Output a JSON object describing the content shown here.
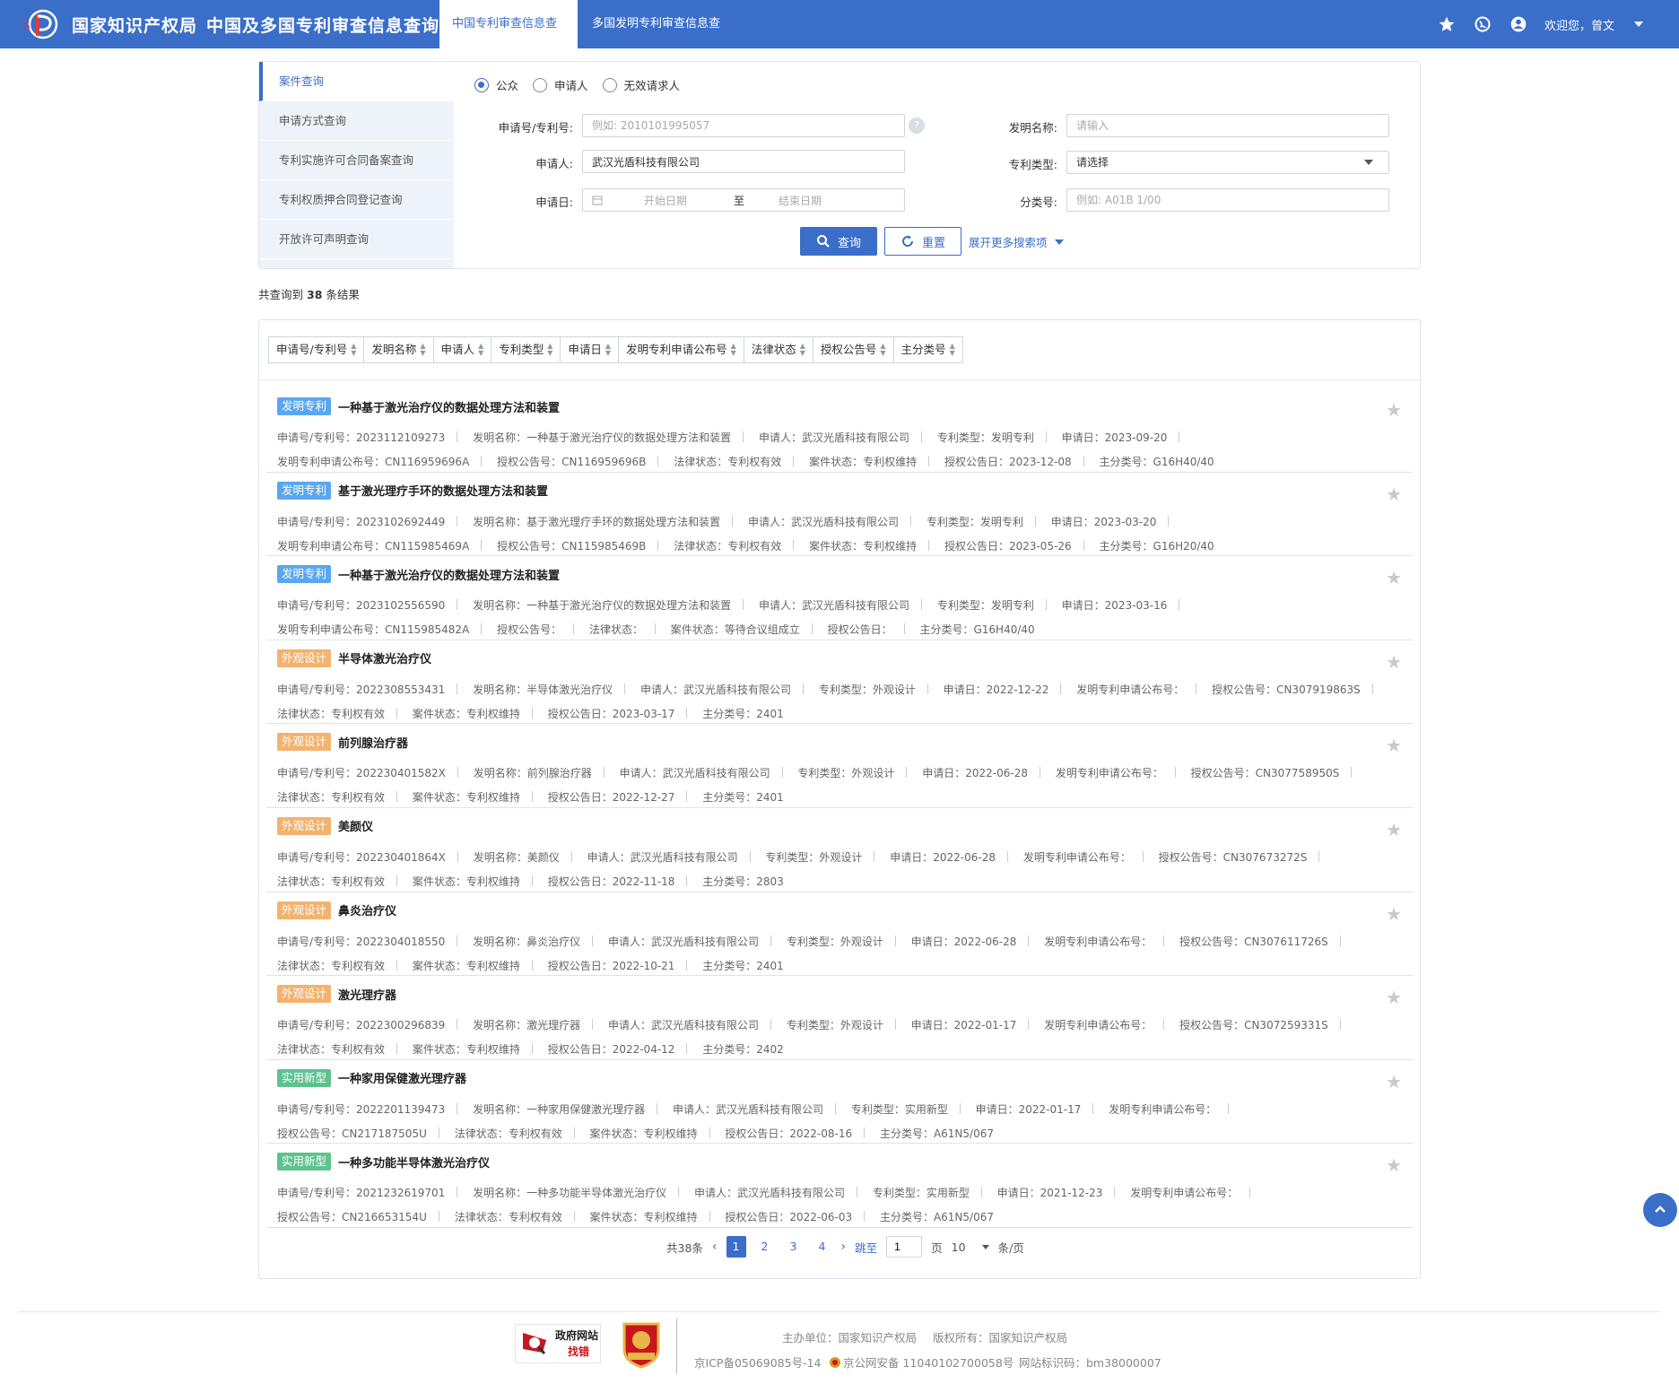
{
  "header": {
    "org_name": "国家知识产权局",
    "system_name": "中国及多国专利审查信息查询",
    "tabs": [
      {
        "label": "中国专利审查信息查询",
        "active": true
      },
      {
        "label": "多国发明专利审查信息查询",
        "active": false
      }
    ],
    "welcome": "欢迎您，曾文",
    "icons": [
      "star-icon",
      "globe-icon",
      "user-icon"
    ]
  },
  "side_menu": [
    {
      "label": "案件查询",
      "active": true
    },
    {
      "label": "申请方式查询"
    },
    {
      "label": "专利实施许可合同备案查询"
    },
    {
      "label": "专利权质押合同登记查询"
    },
    {
      "label": "开放许可声明查询"
    }
  ],
  "search": {
    "roles": [
      {
        "label": "公众",
        "selected": true
      },
      {
        "label": "申请人",
        "selected": false
      },
      {
        "label": "无效请求人",
        "selected": false
      }
    ],
    "app_no_label": "申请号/专利号:",
    "app_no_placeholder": "例如: 2010101995057",
    "applicant_label": "申请人:",
    "applicant_value": "武汉光盾科技有限公司",
    "date_label": "申请日:",
    "date_start_placeholder": "开始日期",
    "date_to": "至",
    "date_end_placeholder": "结束日期",
    "invention_name_label": "发明名称:",
    "invention_name_placeholder": "请输入",
    "patent_type_label": "专利类型:",
    "patent_type_value": "请选择",
    "class_label": "分类号:",
    "class_placeholder": "例如: A01B 1/00",
    "query_button": "查询",
    "reset_button": "重置",
    "more_link": "展开更多搜索项",
    "help_symbol": "?"
  },
  "result_summary": {
    "prefix": "共查询到",
    "count": "38",
    "suffix": "条结果"
  },
  "sort_columns": [
    "申请号/专利号",
    "发明名称",
    "申请人",
    "专利类型",
    "申请日",
    "发明专利申请公布号",
    "法律状态",
    "授权公告号",
    "主分类号"
  ],
  "colors": {
    "primary": "#3a6ec9",
    "badge_invention": "#5aa7ef",
    "badge_design": "#f3b36f",
    "badge_utility": "#5ec28f"
  },
  "records": [
    {
      "badge": "发明专利",
      "badge_color": "#5aa7ef",
      "title": "一种基于激光治疗仪的数据处理方法和装置",
      "fields": [
        "申请号/专利号：2023112109273",
        "发明名称：一种基于激光治疗仪的数据处理方法和装置",
        "申请人：武汉光盾科技有限公司",
        "专利类型：发明专利",
        "申请日：2023-09-20",
        "发明专利申请公布号：CN116959696A",
        "授权公告号：CN116959696B",
        "法律状态：专利权有效",
        "案件状态：专利权维持",
        "授权公告日：2023-12-08",
        "主分类号：G16H40/40"
      ]
    },
    {
      "badge": "发明专利",
      "badge_color": "#5aa7ef",
      "title": "基于激光理疗手环的数据处理方法和装置",
      "fields": [
        "申请号/专利号：2023102692449",
        "发明名称：基于激光理疗手环的数据处理方法和装置",
        "申请人：武汉光盾科技有限公司",
        "专利类型：发明专利",
        "申请日：2023-03-20",
        "发明专利申请公布号：CN115985469A",
        "授权公告号：CN115985469B",
        "法律状态：专利权有效",
        "案件状态：专利权维持",
        "授权公告日：2023-05-26",
        "主分类号：G16H20/40"
      ]
    },
    {
      "badge": "发明专利",
      "badge_color": "#5aa7ef",
      "title": "一种基于激光治疗仪的数据处理方法和装置",
      "fields": [
        "申请号/专利号：2023102556590",
        "发明名称：一种基于激光治疗仪的数据处理方法和装置",
        "申请人：武汉光盾科技有限公司",
        "专利类型：发明专利",
        "申请日：2023-03-16",
        "发明专利申请公布号：CN115985482A",
        "授权公告号：",
        "法律状态：",
        "案件状态：等待合议组成立",
        "授权公告日：",
        "主分类号：G16H40/40"
      ]
    },
    {
      "badge": "外观设计",
      "badge_color": "#f3b36f",
      "title": "半导体激光治疗仪",
      "fields": [
        "申请号/专利号：2022308553431",
        "发明名称：半导体激光治疗仪",
        "申请人：武汉光盾科技有限公司",
        "专利类型：外观设计",
        "申请日：2022-12-22",
        "发明专利申请公布号：",
        "授权公告号：CN307919863S",
        "法律状态：专利权有效",
        "案件状态：专利权维持",
        "授权公告日：2023-03-17",
        "主分类号：2401"
      ]
    },
    {
      "badge": "外观设计",
      "badge_color": "#f3b36f",
      "title": "前列腺治疗器",
      "fields": [
        "申请号/专利号：202230401582X",
        "发明名称：前列腺治疗器",
        "申请人：武汉光盾科技有限公司",
        "专利类型：外观设计",
        "申请日：2022-06-28",
        "发明专利申请公布号：",
        "授权公告号：CN307758950S",
        "法律状态：专利权有效",
        "案件状态：专利权维持",
        "授权公告日：2022-12-27",
        "主分类号：2401"
      ]
    },
    {
      "badge": "外观设计",
      "badge_color": "#f3b36f",
      "title": "美颜仪",
      "fields": [
        "申请号/专利号：202230401864X",
        "发明名称：美颜仪",
        "申请人：武汉光盾科技有限公司",
        "专利类型：外观设计",
        "申请日：2022-06-28",
        "发明专利申请公布号：",
        "授权公告号：CN307673272S",
        "法律状态：专利权有效",
        "案件状态：专利权维持",
        "授权公告日：2022-11-18",
        "主分类号：2803"
      ]
    },
    {
      "badge": "外观设计",
      "badge_color": "#f3b36f",
      "title": "鼻炎治疗仪",
      "fields": [
        "申请号/专利号：2022304018550",
        "发明名称：鼻炎治疗仪",
        "申请人：武汉光盾科技有限公司",
        "专利类型：外观设计",
        "申请日：2022-06-28",
        "发明专利申请公布号：",
        "授权公告号：CN307611726S",
        "法律状态：专利权有效",
        "案件状态：专利权维持",
        "授权公告日：2022-10-21",
        "主分类号：2401"
      ]
    },
    {
      "badge": "外观设计",
      "badge_color": "#f3b36f",
      "title": "激光理疗器",
      "fields": [
        "申请号/专利号：2022300296839",
        "发明名称：激光理疗器",
        "申请人：武汉光盾科技有限公司",
        "专利类型：外观设计",
        "申请日：2022-01-17",
        "发明专利申请公布号：",
        "授权公告号：CN307259331S",
        "法律状态：专利权有效",
        "案件状态：专利权维持",
        "授权公告日：2022-04-12",
        "主分类号：2402"
      ]
    },
    {
      "badge": "实用新型",
      "badge_color": "#5ec28f",
      "title": "一种家用保健激光理疗器",
      "fields": [
        "申请号/专利号：2022201139473",
        "发明名称：一种家用保健激光理疗器",
        "申请人：武汉光盾科技有限公司",
        "专利类型：实用新型",
        "申请日：2022-01-17",
        "发明专利申请公布号：",
        "授权公告号：CN217187505U",
        "法律状态：专利权有效",
        "案件状态：专利权维持",
        "授权公告日：2022-08-16",
        "主分类号：A61N5/067"
      ]
    },
    {
      "badge": "实用新型",
      "badge_color": "#5ec28f",
      "title": "一种多功能半导体激光治疗仪",
      "fields": [
        "申请号/专利号：2021232619701",
        "发明名称：一种多功能半导体激光治疗仪",
        "申请人：武汉光盾科技有限公司",
        "专利类型：实用新型",
        "申请日：2021-12-23",
        "发明专利申请公布号：",
        "授权公告号：CN216653154U",
        "法律状态：专利权有效",
        "案件状态：专利权维持",
        "授权公告日：2022-06-03",
        "主分类号：A61N5/067"
      ]
    }
  ],
  "pagination": {
    "total": "共38条",
    "pages": [
      "1",
      "2",
      "3",
      "4"
    ],
    "current": "1",
    "jump_label": "跳至",
    "jump_value": "1",
    "page_unit": "页",
    "page_size": "10",
    "size_unit": "条/页"
  },
  "footer": {
    "badge_gov_line1": "政府网站",
    "badge_gov_line2": "找错",
    "host": "主办单位：国家知识产权局",
    "copyright": "版权所有：国家知识产权局",
    "icp": "京ICP备05069085号-14",
    "police": "京公网安备 11040102700058号",
    "site_id": "网站标识码：bm38000007"
  }
}
